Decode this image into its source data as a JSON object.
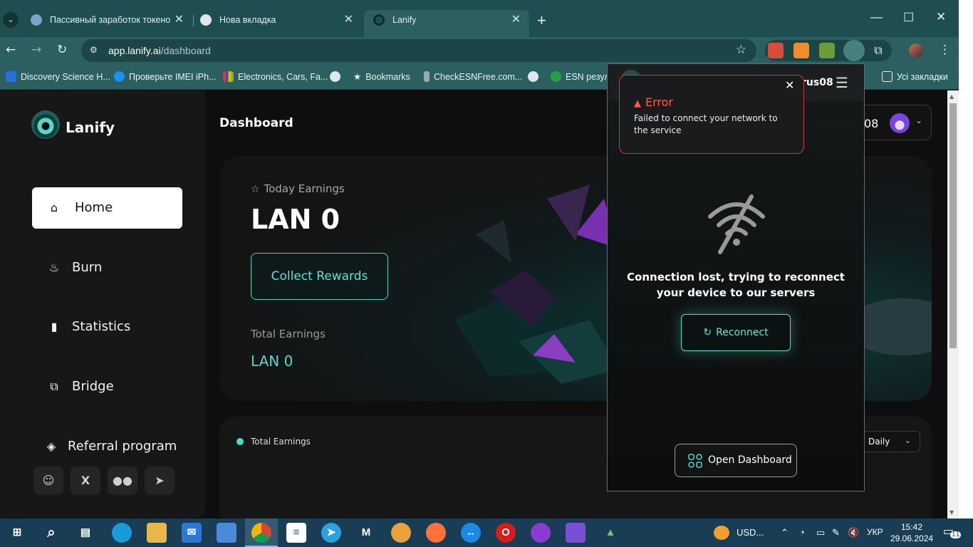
{
  "browser": {
    "tabs": [
      {
        "title": "Пассивный заработок токено",
        "active": false
      },
      {
        "title": "Нова вкладка",
        "active": false
      },
      {
        "title": "Lanify",
        "active": true
      }
    ],
    "url_host": "app.lanify.ai",
    "url_path": "/dashboard",
    "bookmarks": [
      "Discovery Science H...",
      "Проверьте IMEI iPh...",
      "Electronics, Cars, Fa...",
      "Bookmarks",
      "CheckESNFree.com...",
      "ESN резул",
      "Усі закладки"
    ]
  },
  "app": {
    "brand": "Lanify",
    "nav": [
      {
        "label": "Home",
        "icon": "home-icon",
        "active": true
      },
      {
        "label": "Burn",
        "icon": "flame-icon",
        "active": false
      },
      {
        "label": "Statistics",
        "icon": "bar-chart-icon",
        "active": false
      },
      {
        "label": "Bridge",
        "icon": "bridge-icon",
        "active": false
      },
      {
        "label": "Referral program",
        "icon": "layers-icon",
        "active": false
      }
    ],
    "socials": [
      "discord-icon",
      "x-icon",
      "medium-icon",
      "telegram-icon"
    ],
    "page_title": "Dashboard",
    "user_label": "08",
    "today_label": "Today Earnings",
    "today_value": "LAN 0",
    "collect_label": "Collect Rewards",
    "total_label": "Total Earnings",
    "total_value": "LAN 0",
    "chart_legend": "Total Earnings",
    "period": "Daily"
  },
  "popup": {
    "user_label": "rus08",
    "error_title": "Error",
    "error_message": "Failed to connect your network to the service",
    "connection_message": "Connection lost, trying to reconnect your device to our servers",
    "reconnect_label": "Reconnect",
    "open_dashboard_label": "Open Dashboard"
  },
  "taskbar": {
    "tray_label": "USD...",
    "language": "УКР",
    "time": "15:42",
    "date": "29.06.2024",
    "notifications": "11"
  },
  "colors": {
    "accent": "#3ee0cf",
    "error": "#ff5b52",
    "chrome_frame": "#1e4e4f",
    "taskbar": "#1a3d56"
  }
}
